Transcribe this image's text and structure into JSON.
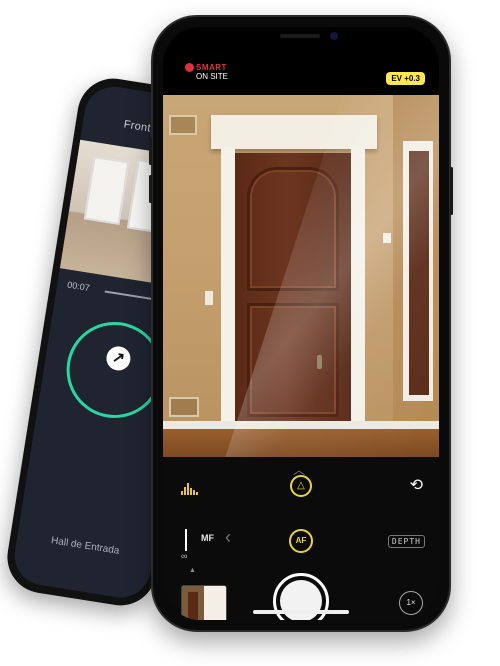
{
  "back_phone": {
    "title": "Front Door",
    "playback_time": "00:07",
    "footer_label": "Hall de Entrada"
  },
  "front_phone": {
    "logo": {
      "line1": "SMART",
      "line2": "ON SITE"
    },
    "ev_badge": "EV +0.3",
    "controls": {
      "mf_label": "MF",
      "infinity_symbol": "∞",
      "af_label": "AF",
      "depth_label": "DEPTH",
      "zoom_label": "1×"
    },
    "icons": {
      "histogram": "histogram-icon",
      "chevron_up": "chevron-up-icon",
      "triangle": "triangle-icon",
      "rotate": "rotate-camera-icon",
      "chevron_left": "chevron-left-icon",
      "up_triangle": "up-triangle-icon"
    }
  },
  "colors": {
    "accent_yellow": "#e6d53a",
    "logo_red": "#e0313a",
    "ring_green": "#2ad7a2"
  }
}
